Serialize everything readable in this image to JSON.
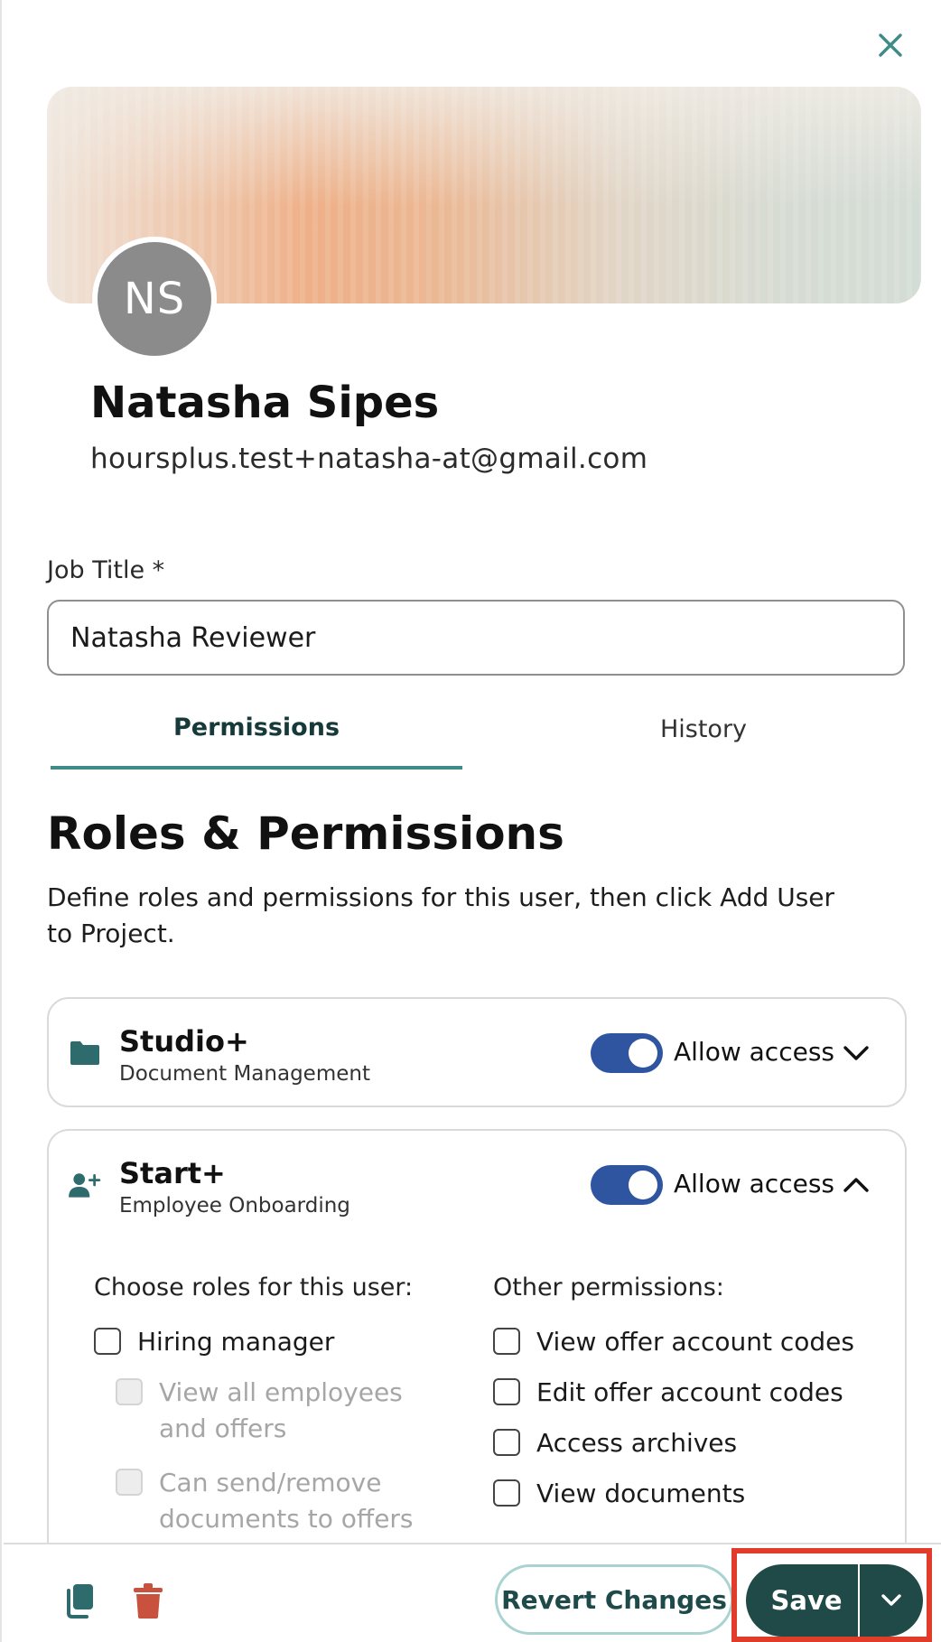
{
  "header": {
    "close_icon": "close-icon"
  },
  "profile": {
    "initials": "NS",
    "name": "Natasha Sipes",
    "email": "hoursplus.test+natasha-at@gmail.com"
  },
  "job_title": {
    "label": "Job Title *",
    "value": "Natasha Reviewer",
    "placeholder": ""
  },
  "tabs": [
    {
      "label": "Permissions",
      "active": true
    },
    {
      "label": "History",
      "active": false
    }
  ],
  "roles": {
    "title": "Roles & Permissions",
    "description": "Define roles and permissions for this user, then click Add User to Project."
  },
  "products": [
    {
      "name": "Studio+",
      "subtitle": "Document Management",
      "icon": "folder-icon",
      "access_label": "Allow access",
      "access_on": true,
      "expanded": false
    },
    {
      "name": "Start+",
      "subtitle": "Employee Onboarding",
      "icon": "user-plus-icon",
      "access_label": "Allow access",
      "access_on": true,
      "expanded": true,
      "roles_heading": "Choose roles for this user:",
      "roles": [
        {
          "label": "Hiring manager",
          "checked": false,
          "disabled": false
        },
        {
          "label": "View all employees and offers",
          "checked": false,
          "disabled": true
        },
        {
          "label": "Can send/remove documents to offers",
          "checked": false,
          "disabled": true
        }
      ],
      "other_heading": "Other permissions:",
      "other_permissions": [
        {
          "label": "View offer account codes",
          "checked": false
        },
        {
          "label": "Edit offer account codes",
          "checked": false
        },
        {
          "label": "Access archives",
          "checked": false
        },
        {
          "label": "View documents",
          "checked": false
        }
      ]
    }
  ],
  "footer": {
    "duplicate_icon": "copy-icon",
    "delete_icon": "trash-icon",
    "revert_label": "Revert Changes",
    "save_label": "Save",
    "save_menu_icon": "chevron-down-icon"
  },
  "colors": {
    "accent": "#3e8b88",
    "toggle_on": "#2f54a0",
    "primary_button": "#1f4a47",
    "delete_icon": "#c9523f",
    "highlight": "#e13b2a"
  }
}
